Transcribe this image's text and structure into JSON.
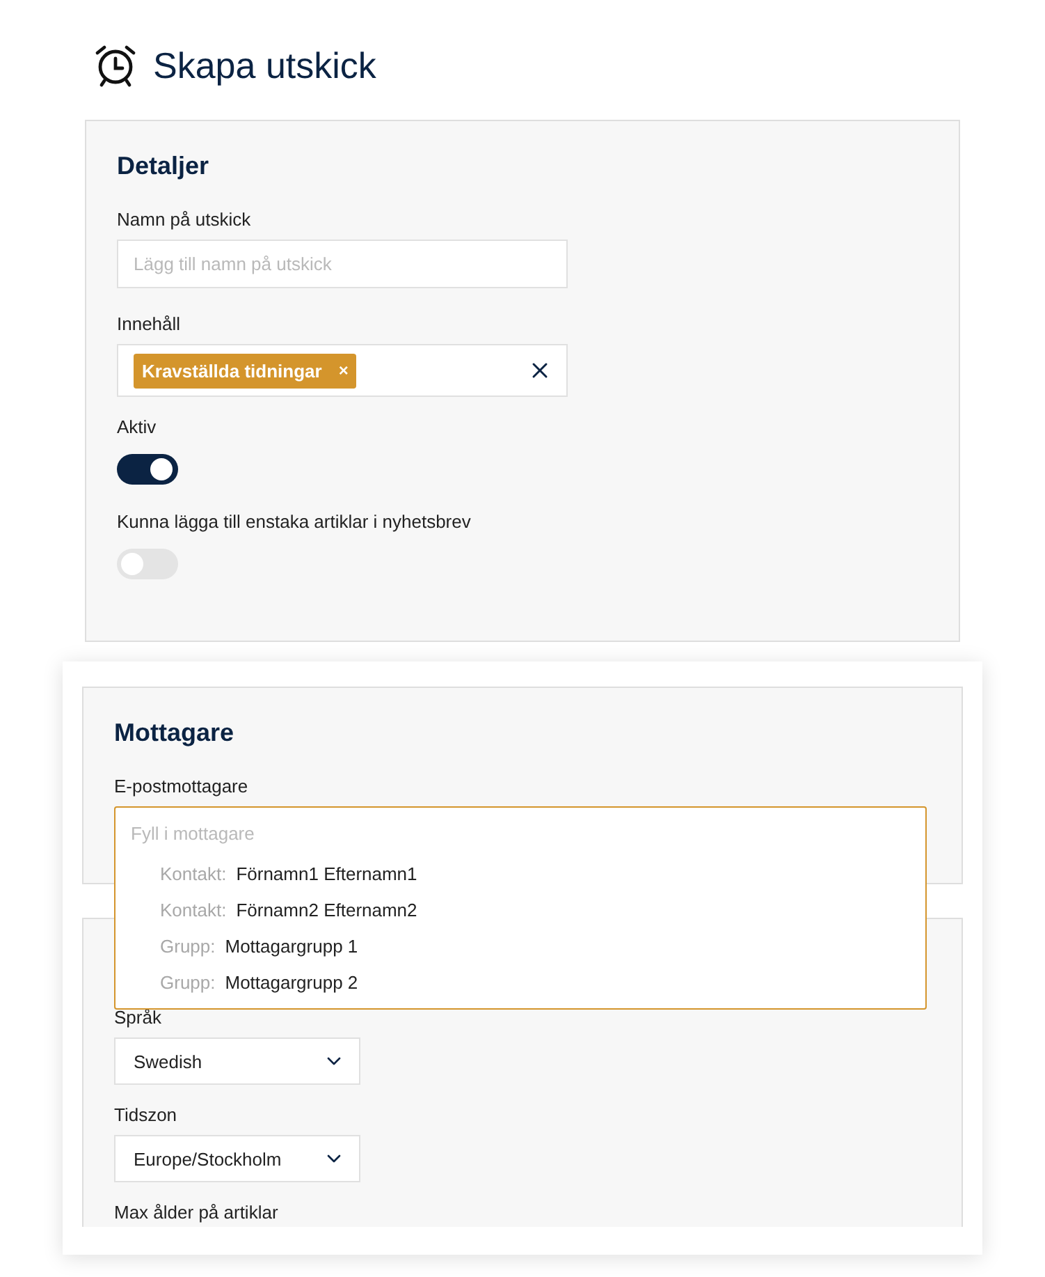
{
  "page": {
    "title": "Skapa utskick"
  },
  "details": {
    "heading": "Detaljer",
    "name_field": {
      "label": "Namn på utskick",
      "placeholder": "Lägg till namn på utskick"
    },
    "content_field": {
      "label": "Innehåll",
      "tags": [
        {
          "label": "Kravställda tidningar",
          "remove": "×"
        }
      ]
    },
    "toggles": [
      {
        "label": "Aktiv",
        "on": true
      },
      {
        "label": "Kunna lägga till enstaka artiklar i nyhetsbrev",
        "on": false
      }
    ]
  },
  "recipients": {
    "heading": "Mottagare",
    "field": {
      "label": "E-postmottagare",
      "placeholder": "Fyll i mottagare",
      "expanded": true,
      "options": [
        {
          "type": "Kontakt:",
          "name": "Förnamn1 Efternamn1"
        },
        {
          "type": "Kontakt:",
          "name": "Förnamn2 Efternamn2"
        },
        {
          "type": "Grupp:",
          "name": "Mottagargrupp 1"
        },
        {
          "type": "Grupp:",
          "name": "Mottagargrupp 2"
        }
      ]
    }
  },
  "settings": {
    "selects": [
      {
        "label": "Språk",
        "value": "Swedish"
      },
      {
        "label": "Tidszon",
        "value": "Europe/Stockholm"
      }
    ],
    "next_label": "Max ålder på artiklar"
  }
}
